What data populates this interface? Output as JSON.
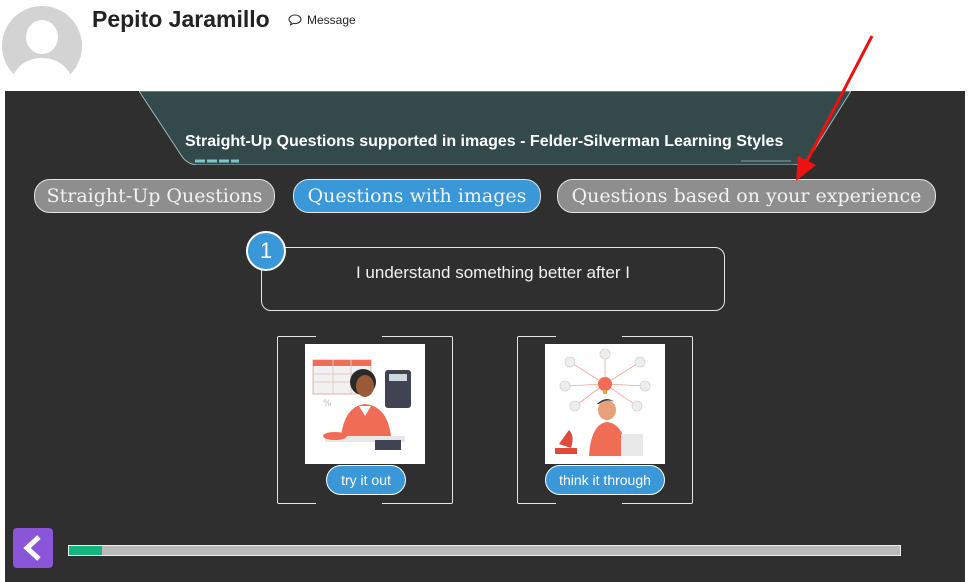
{
  "profile": {
    "name": "Pepito Jaramillo",
    "message_label": "Message",
    "message_icon": "speech-bubble-icon",
    "avatar_icon": "default-user-avatar"
  },
  "quiz": {
    "title": "Straight-Up Questions supported in images - Felder-Silverman Learning Styles",
    "tabs": [
      {
        "label": "Straight-Up Questions",
        "active": false
      },
      {
        "label": "Questions with images",
        "active": true
      },
      {
        "label": "Questions based on your experience",
        "active": false
      }
    ],
    "question": {
      "number": "1",
      "text": "I understand something better after I"
    },
    "options": [
      {
        "label": "try it out",
        "image": "woman-with-calculator-illustration"
      },
      {
        "label": "think it through",
        "image": "man-thinking-illustration"
      }
    ],
    "progress": 0.04
  },
  "colors": {
    "panel_bg": "#2f2f2f",
    "title_tab_bg": "#344a4a",
    "accent_blue": "#3a98d8",
    "inactive_tab": "#8e8e8e",
    "back_button": "#8a55d8",
    "progress_fill": "#14b67e",
    "annotation_arrow": "#ee1111"
  }
}
